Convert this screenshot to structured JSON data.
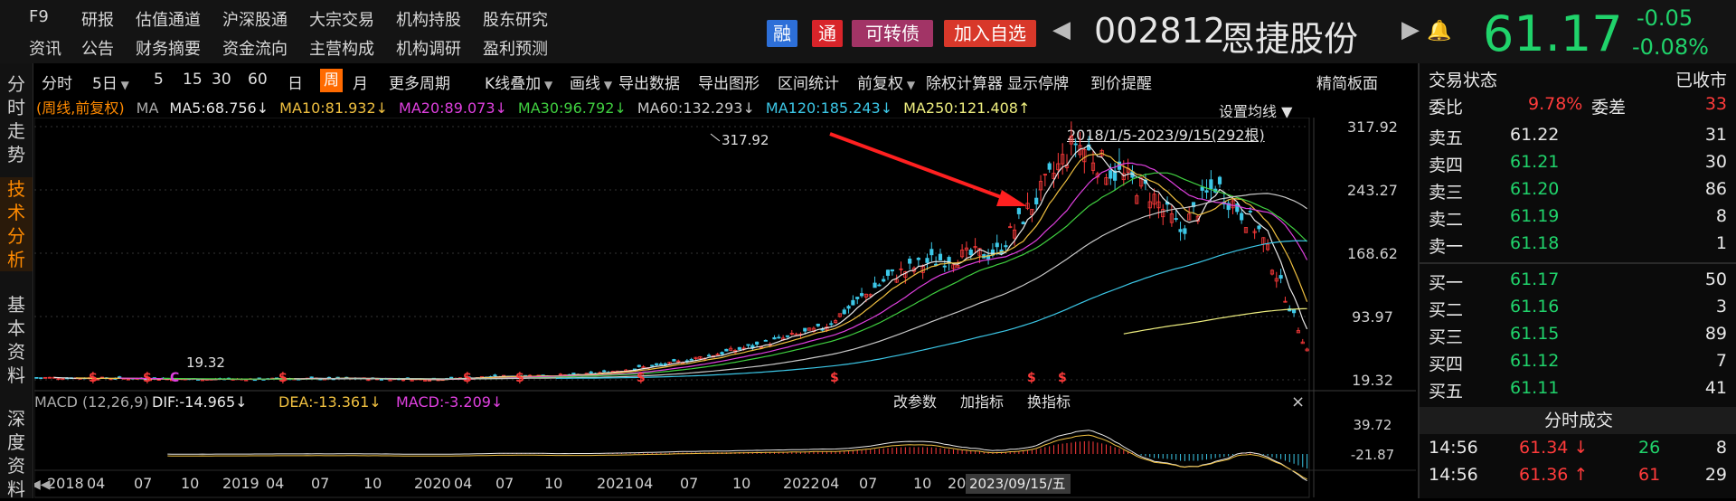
{
  "nav": {
    "row1": [
      "F9",
      "研报",
      "估值通道",
      "沪深股通",
      "大宗交易",
      "机构持股",
      "股东研究"
    ],
    "row2": [
      "资讯",
      "公告",
      "财务摘要",
      "资金流向",
      "主营构成",
      "机构调研",
      "盈利预测"
    ]
  },
  "header": {
    "badges": [
      {
        "label": "融",
        "color": "#2d6fd8"
      },
      {
        "label": "通",
        "color": "#d8242a"
      },
      {
        "label": "可转债",
        "color": "#a23466"
      },
      {
        "label": "加入自选",
        "color": "#d8382a"
      }
    ],
    "code": "002812",
    "name": "恩捷股份",
    "price": "61.17",
    "change": "-0.05",
    "change_pct": "-0.08%"
  },
  "left_tabs": [
    "分\n时\n走\n势",
    "技\n术\n分\n析",
    "基\n本\n资\n料",
    "深\n度\n资\n料"
  ],
  "toolbar": {
    "items": [
      "分时",
      "5日",
      "5",
      "15",
      "30",
      "60",
      "日",
      "周",
      "月",
      "更多周期",
      "K线叠加",
      "画线",
      "导出数据",
      "导出图形",
      "区间统计",
      "前复权",
      "除权计算器",
      "显示停牌",
      "到价提醒"
    ],
    "active": "周",
    "right": "精简板面"
  },
  "ma_line": {
    "prefix": "(周线,前复权)",
    "label": "MA",
    "items": [
      {
        "text": "MA5:68.756↓",
        "color": "#e8e8e8"
      },
      {
        "text": "MA10:81.932↓",
        "color": "#f0c040"
      },
      {
        "text": "MA20:89.073↓",
        "color": "#e040e0"
      },
      {
        "text": "MA30:96.792↓",
        "color": "#40d040"
      },
      {
        "text": "MA60:132.293↓",
        "color": "#c8c8c8"
      },
      {
        "text": "MA120:185.243↓",
        "color": "#3cc8e8"
      },
      {
        "text": "MA250:121.408↑",
        "color": "#f0f080"
      }
    ],
    "settings": "设置均线",
    "range": "2018/1/5-2023/9/15(292根)"
  },
  "chart_data": {
    "type": "candlestick",
    "peak_label": "317.92",
    "low_label": "19.32",
    "y_ticks": [
      "317.92",
      "243.27",
      "168.62",
      "93.97",
      "19.32"
    ],
    "x_ticks": [
      "2018",
      "04",
      "07",
      "10",
      "2019",
      "04",
      "07",
      "10",
      "2020",
      "04",
      "07",
      "10",
      "2021",
      "04",
      "07",
      "10",
      "2022",
      "04",
      "07",
      "10",
      "20"
    ],
    "cursor_date": "2023/09/15/五"
  },
  "macd": {
    "label": "MACD (12,26,9)",
    "dif": "DIF:-14.965↓",
    "dea": "DEA:-13.361↓",
    "macd": "MACD:-3.209↓",
    "buttons": [
      "改参数",
      "加指标",
      "换指标"
    ],
    "y_ticks": [
      "39.72",
      "-21.87"
    ]
  },
  "right_panel": {
    "status_label": "交易状态",
    "status": "已收市",
    "wb_label": "委比",
    "wb": "9.78%",
    "wc_label": "委差",
    "wc": "33",
    "asks": [
      {
        "l": "卖五",
        "p": "61.22",
        "v": "31",
        "c": "white"
      },
      {
        "l": "卖四",
        "p": "61.21",
        "v": "30",
        "c": "green"
      },
      {
        "l": "卖三",
        "p": "61.20",
        "v": "86",
        "c": "green"
      },
      {
        "l": "卖二",
        "p": "61.19",
        "v": "8",
        "c": "green"
      },
      {
        "l": "卖一",
        "p": "61.18",
        "v": "1",
        "c": "green"
      }
    ],
    "bids": [
      {
        "l": "买一",
        "p": "61.17",
        "v": "50",
        "c": "green"
      },
      {
        "l": "买二",
        "p": "61.16",
        "v": "3",
        "c": "green"
      },
      {
        "l": "买三",
        "p": "61.15",
        "v": "89",
        "c": "green"
      },
      {
        "l": "买四",
        "p": "61.12",
        "v": "7",
        "c": "green"
      },
      {
        "l": "买五",
        "p": "61.11",
        "v": "41",
        "c": "green"
      }
    ],
    "ticks_title": "分时成交",
    "ticks": [
      {
        "t": "14:56",
        "p": "61.34",
        "arrow": "↓",
        "v": "26",
        "n": "8",
        "pc": "red",
        "vc": "green"
      },
      {
        "t": "14:56",
        "p": "61.36",
        "arrow": "↑",
        "v": "61",
        "n": "29",
        "pc": "red",
        "vc": "red"
      }
    ]
  }
}
